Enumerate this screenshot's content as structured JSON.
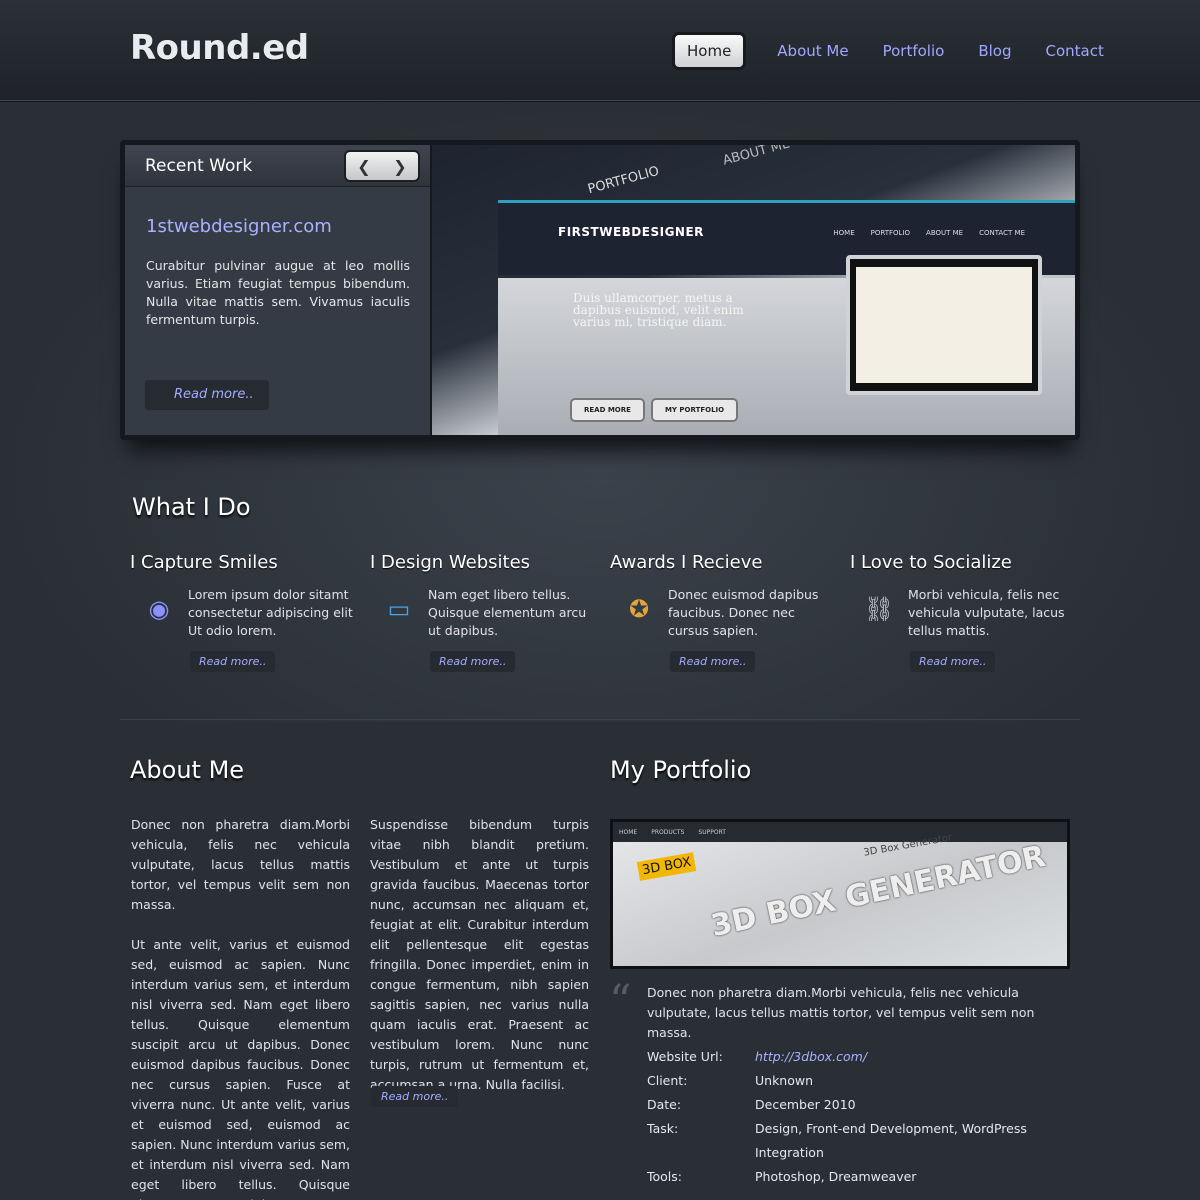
{
  "header": {
    "logo": "Round.ed",
    "nav": [
      "Home",
      "About Me",
      "Portfolio",
      "Blog",
      "Contact"
    ]
  },
  "slider": {
    "heading": "Recent Work",
    "prev": "❮",
    "next": "❯",
    "title": "1stwebdesigner.com",
    "text": "Curabitur pulvinar augue at leo mollis varius. Etiam feugiat tempus bibendum. Nulla vitae mattis sem. Vivamus iaculis fermentum turpis.",
    "read_more": "Read more..",
    "preview": {
      "brand": "FIRSTWEBDESIGNER",
      "nav": [
        "HOME",
        "PORTFOLIO",
        "ABOUT ME",
        "CONTACT ME"
      ],
      "tagline": "Duis ullamcorper, metus a dapibus euismod, velit enim varius mi, tristique diam.",
      "btn_read": "READ MORE",
      "btn_portfolio": "MY PORTFOLIO",
      "portfolio_tab": "PORTFOLIO",
      "about_tab": "ABOUT ME"
    }
  },
  "what_i_do": {
    "title": "What I Do",
    "features": [
      {
        "title": "I Capture Smiles",
        "text": "Lorem ipsum dolor sitamt consectetur adipiscing elit Ut odio lorem.",
        "read": "Read more..",
        "icon": "◉"
      },
      {
        "title": "I Design Websites",
        "text": "Nam eget libero tellus. Quisque elementum arcu ut dapibus.",
        "read": "Read more..",
        "icon": "▭"
      },
      {
        "title": "Awards I Recieve",
        "text": "Donec euismod dapibus faucibus. Donec nec cursus sapien.",
        "read": "Read more..",
        "icon": "✪"
      },
      {
        "title": "I Love to Socialize",
        "text": "Morbi vehicula, felis nec vehicula vulputate, lacus tellus mattis.",
        "read": "Read more..",
        "icon": "⛓"
      }
    ]
  },
  "about": {
    "title": "About Me",
    "col1": [
      "Donec non pharetra diam.Morbi vehicula, felis nec vehicula vulputate, lacus tellus mattis tortor, vel tempus velit sem non massa.",
      "Ut ante velit, varius et euismod sed, euismod ac sapien. Nunc interdum varius sem, et interdum nisl viverra sed. Nam eget libero tellus. Quisque elementum suscipit arcu ut dapibus. Donec euismod dapibus faucibus. Donec nec cursus sapien. Fusce at viverra nunc. Ut ante velit, varius et euismod sed, euismod ac sapien. Nunc interdum varius sem, et interdum nisl viverra sed. Nam eget libero tellus. Quisque elementum suscipit arcu ut dapibus."
    ],
    "col2": "Suspendisse bibendum turpis vitae nibh blandit pretium. Vestibulum et ante ut turpis gravida faucibus. Maecenas tortor nunc, accumsan nec aliquam et, feugiat at elit. Curabitur interdum elit pellentesque elit egestas fringilla. Donec imperdiet, enim in congue fermentum, nibh sapien sagittis sapien, nec varius nulla quam iaculis erat. Praesent ac vestibulum lorem. Nunc nunc turpis, rutrum ut fermentum et, accumsan a urna. Nulla facilisi.",
    "read_more": "Read more.."
  },
  "portfolio": {
    "title": "My Portfolio",
    "image": {
      "nav": [
        "HOME",
        "PRODUCTS",
        "SUPPORT"
      ],
      "box_label": "3D BOX",
      "big_text": "3D BOX GENERATOR",
      "heading": "3D Box Generator"
    },
    "quote_mark": "“",
    "description": "Donec non pharetra diam.Morbi vehicula, felis nec vehicula vulputate, lacus tellus mattis tortor, vel tempus velit sem non massa.",
    "details": [
      {
        "label": "Website Url:",
        "value": "http://3dbox.com/"
      },
      {
        "label": "Client:",
        "value": "Unknown"
      },
      {
        "label": "Date:",
        "value": "December 2010"
      },
      {
        "label": "Task:",
        "value": "Design, Front-end Development, WordPress Integration"
      },
      {
        "label": "Tools:",
        "value": "Photoshop, Dreamweaver"
      }
    ]
  }
}
